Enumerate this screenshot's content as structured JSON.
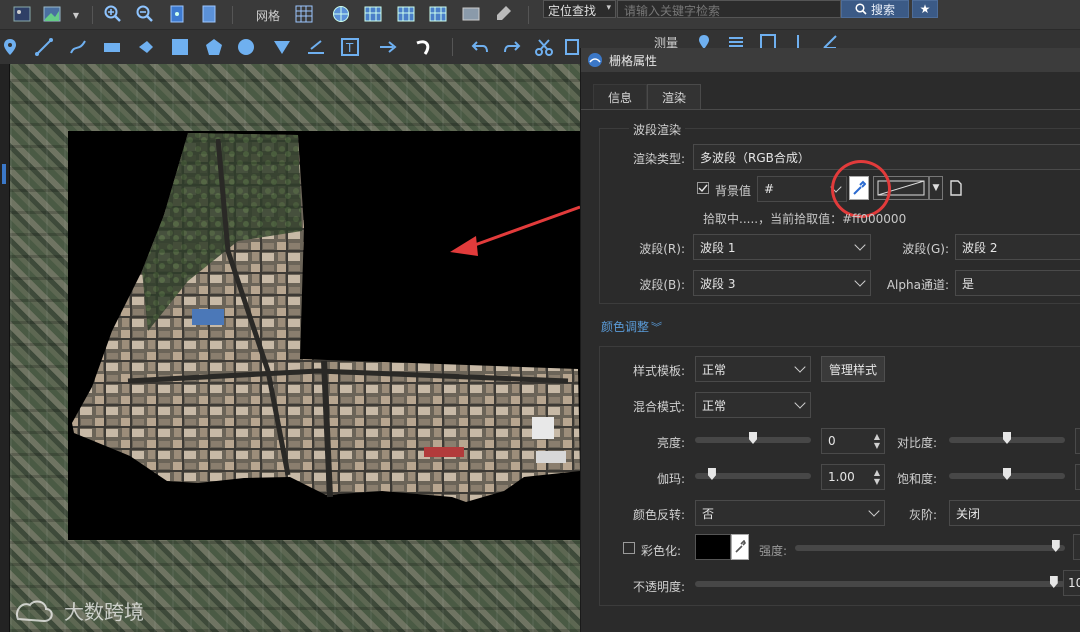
{
  "toolbar": {
    "grid_label": "网格",
    "locate_select": "定位查找",
    "search_placeholder": "请输入关键字检索",
    "search_button": "搜索",
    "measure_label": "测量"
  },
  "panel": {
    "title": "栅格属性",
    "tabs": [
      "信息",
      "渲染"
    ],
    "band_render": {
      "section_title": "波段渲染",
      "render_type_label": "渲染类型:",
      "render_type_value": "多波段（RGB合成）",
      "bg_checkbox_label": "背景值",
      "bg_value": "#",
      "pick_status": "拾取中.....，当前拾取值：#ff000000",
      "band_r_label": "波段(R):",
      "band_r_value": "波段 1",
      "band_g_label": "波段(G):",
      "band_g_value": "波段 2",
      "band_b_label": "波段(B):",
      "band_b_value": "波段 3",
      "alpha_label": "Alpha通道:",
      "alpha_value": "是"
    },
    "color_adjust": {
      "section_title": "颜色调整",
      "style_template_label": "样式模板:",
      "style_template_value": "正常",
      "manage_style_button": "管理样式",
      "blend_mode_label": "混合模式:",
      "blend_mode_value": "正常",
      "brightness_label": "亮度:",
      "brightness_value": "0",
      "brightness_level": 0.5,
      "contrast_label": "对比度:",
      "contrast_level": 0.5,
      "gamma_label": "伽玛:",
      "gamma_value": "1.00",
      "gamma_level": 0.12,
      "saturation_label": "饱和度:",
      "saturation_level": 0.5,
      "invert_label": "颜色反转:",
      "invert_value": "否",
      "grayscale_label": "灰阶:",
      "grayscale_value": "关闭",
      "colorize_label": "彩色化:",
      "intensity_label": "强度:",
      "intensity_level": 0.98,
      "opacity_label": "不透明度:",
      "opacity_value": "10",
      "opacity_level": 0.98
    }
  },
  "watermark": {
    "text": "大数跨境"
  },
  "colors": {
    "accent_blue": "#3b5a86",
    "annotation_red": "#e23b3b",
    "link_blue": "#5a9bd8"
  }
}
